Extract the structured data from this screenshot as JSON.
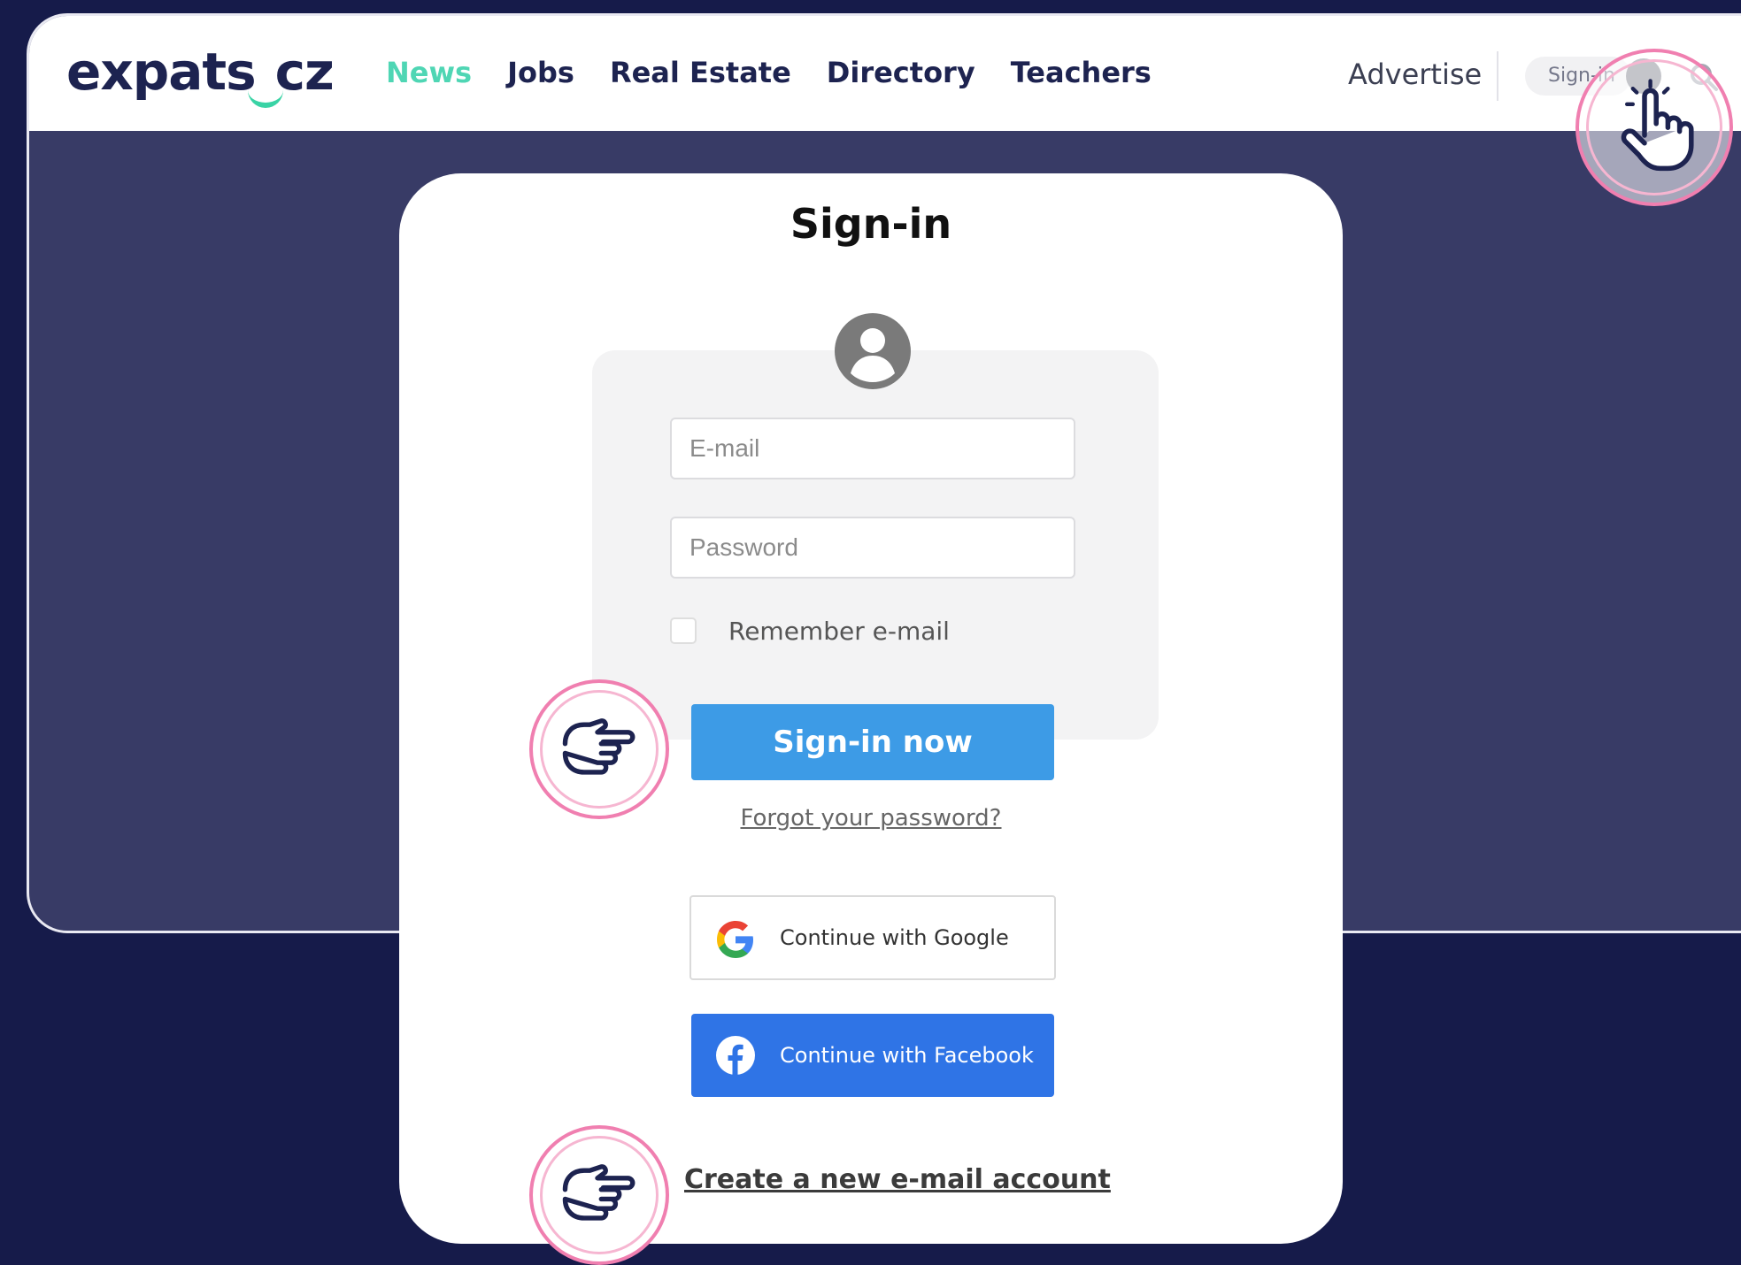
{
  "header": {
    "logo_text": "expats",
    "logo_suffix": "cz",
    "nav": [
      {
        "label": "News",
        "active": true
      },
      {
        "label": "Jobs"
      },
      {
        "label": "Real Estate"
      },
      {
        "label": "Directory"
      },
      {
        "label": "Teachers"
      }
    ],
    "advertise_label": "Advertise",
    "signin_label": "Sign-in"
  },
  "signin_card": {
    "title": "Sign-in",
    "email_placeholder": "E-mail",
    "password_placeholder": "Password",
    "remember_label": "Remember e-mail",
    "signin_button": "Sign-in now",
    "forgot_link": "Forgot your password?",
    "google_button": "Continue with Google",
    "facebook_button": "Continue with Facebook",
    "create_account_link": "Create a new e-mail account"
  },
  "colors": {
    "background": "#161b4a",
    "accent_news": "#4fd6b4",
    "signin_button": "#3d9be6",
    "facebook_button": "#2f74e6",
    "pointer_ring": "#f07fb0"
  },
  "icons": [
    "user-avatar-icon",
    "search-icon",
    "google-icon",
    "facebook-icon",
    "pointer-hand-icon",
    "click-hand-icon"
  ]
}
